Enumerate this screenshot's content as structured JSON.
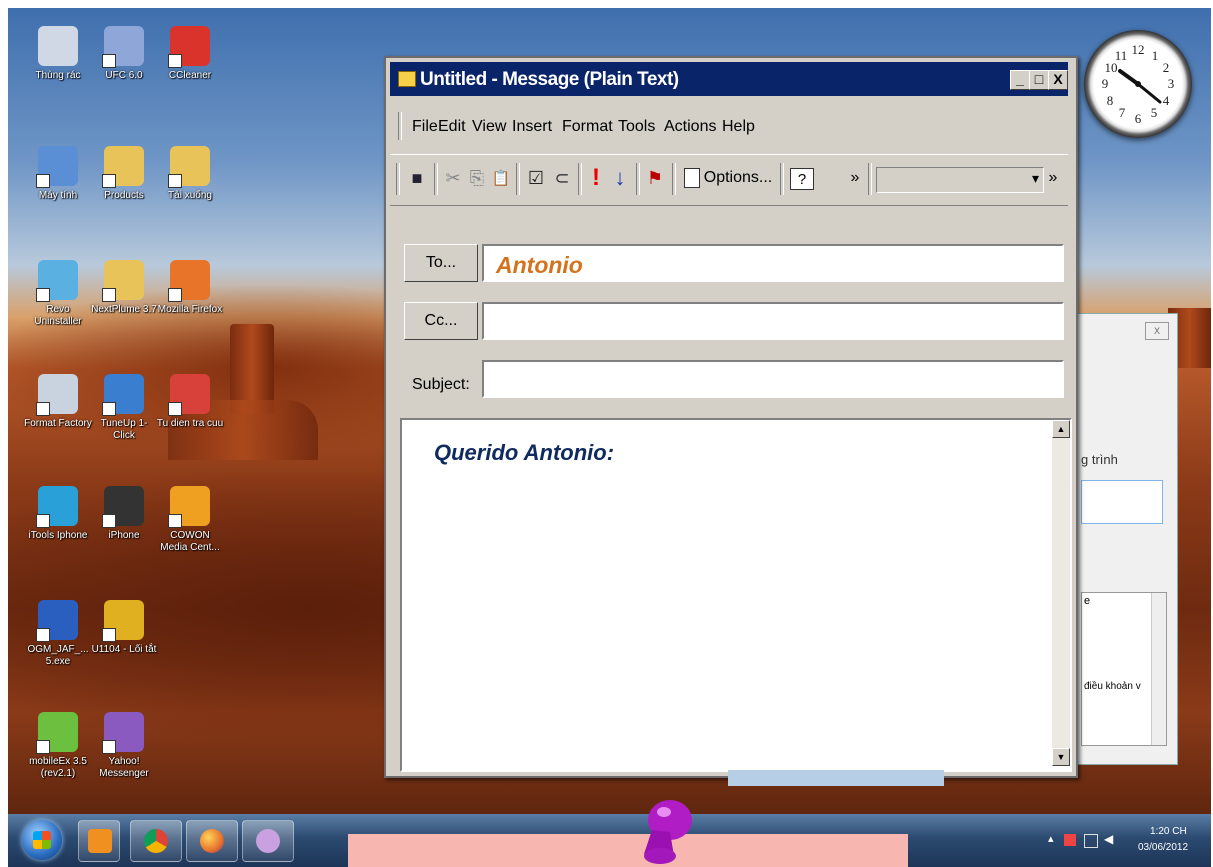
{
  "desktop": {
    "icons": [
      {
        "label": "Thùng rác",
        "icon": "recycle-bin-icon",
        "color": "#cfd8e4"
      },
      {
        "label": "UFC 6.0",
        "icon": "cd-icon",
        "color": "#8fa7d8"
      },
      {
        "label": "CCleaner",
        "icon": "ccleaner-icon",
        "color": "#d9332b"
      },
      {
        "label": "Máy tính",
        "icon": "computer-icon",
        "color": "#5a8fd6"
      },
      {
        "label": "Products",
        "icon": "folder-icon",
        "color": "#e8c35a"
      },
      {
        "label": "Tải xuống",
        "icon": "download-folder-icon",
        "color": "#e8c35a"
      },
      {
        "label": "Revo Uninstaller",
        "icon": "revo-uninstaller-icon",
        "color": "#5ab0e0"
      },
      {
        "label": "NextPlume 3.7",
        "icon": "document-icon",
        "color": "#e8c35a"
      },
      {
        "label": "Mozilla Firefox",
        "icon": "firefox-icon",
        "color": "#e8742a"
      },
      {
        "label": "Format Factory",
        "icon": "format-factory-icon",
        "color": "#c9d3df"
      },
      {
        "label": "TuneUp 1-Click",
        "icon": "tuneup-icon",
        "color": "#3a7ed0"
      },
      {
        "label": "Tu dien tra cuu",
        "icon": "dictionary-icon",
        "color": "#d8413a"
      },
      {
        "label": "iTools Iphone",
        "icon": "itools-icon",
        "color": "#2aa0d8"
      },
      {
        "label": "iPhone",
        "icon": "iphone-icon",
        "color": "#333333"
      },
      {
        "label": "COWON Media Cent...",
        "icon": "cowon-icon",
        "color": "#f0a020"
      },
      {
        "label": "OGM_JAF_... 5.exe",
        "icon": "installer-icon",
        "color": "#2a5fc0"
      },
      {
        "label": "U1104 - Lối tắt",
        "icon": "shortcut-icon",
        "color": "#e0b020"
      },
      {
        "label": "",
        "icon": "blank-icon",
        "color": "transparent"
      },
      {
        "label": "mobileEx 3.5 (rev2.1)",
        "icon": "mobileex-icon",
        "color": "#6cc040"
      },
      {
        "label": "Yahoo! Messenger",
        "icon": "yahoo-messenger-icon",
        "color": "#8a5ac0"
      }
    ]
  },
  "window": {
    "title": "Untitled - Message (Plain Text)",
    "controls": {
      "minimize": "_",
      "maximize": "□",
      "close": "X"
    },
    "menus": [
      {
        "label": "File",
        "key": "F",
        "rest": "ile"
      },
      {
        "label": "Edit",
        "key": "E",
        "rest": "dit"
      },
      {
        "label": "View",
        "key": "V",
        "rest": "iew"
      },
      {
        "label": "Insert",
        "key": "I",
        "rest": "nsert"
      },
      {
        "label": "Format",
        "key": "o",
        "pre": "F",
        "rest": "rmat"
      },
      {
        "label": "Tools",
        "key": "T",
        "rest": "ools"
      },
      {
        "label": "Actions",
        "key": "A",
        "rest": "ctions"
      },
      {
        "label": "Help",
        "key": "H",
        "rest": "elp"
      }
    ],
    "toolbar": {
      "save_icon": "■",
      "cut_icon": "✂",
      "copy_icon": "⎘",
      "paste_icon": "📋",
      "check_icon": "☑",
      "attach_icon": "⊂",
      "high_importance_icon": "!",
      "low_importance_icon": "↓",
      "flag_icon": "⚑",
      "options_label": "Options...",
      "help_icon": "?",
      "overflow_icon": "»",
      "dropdown_arrow": "▾"
    },
    "to_button": "To...",
    "cc_button": "Cc...",
    "subject_label": "Subject:",
    "to_value": "Antonio",
    "cc_value": "",
    "subject_value": "",
    "body_text": "Querido Antonio:"
  },
  "background_window": {
    "close": "X",
    "text_1": "g trình",
    "text_2": "e",
    "text_3": "điều khoản v"
  },
  "taskbar": {
    "time": "1:20 CH",
    "date": "03/06/2012",
    "tray_arrow": "▴"
  },
  "colors": {
    "title_bar": "#0a246a",
    "to_text": "#d4731c",
    "body_text": "#0e2a5e",
    "window_face": "#d4d0c8"
  }
}
